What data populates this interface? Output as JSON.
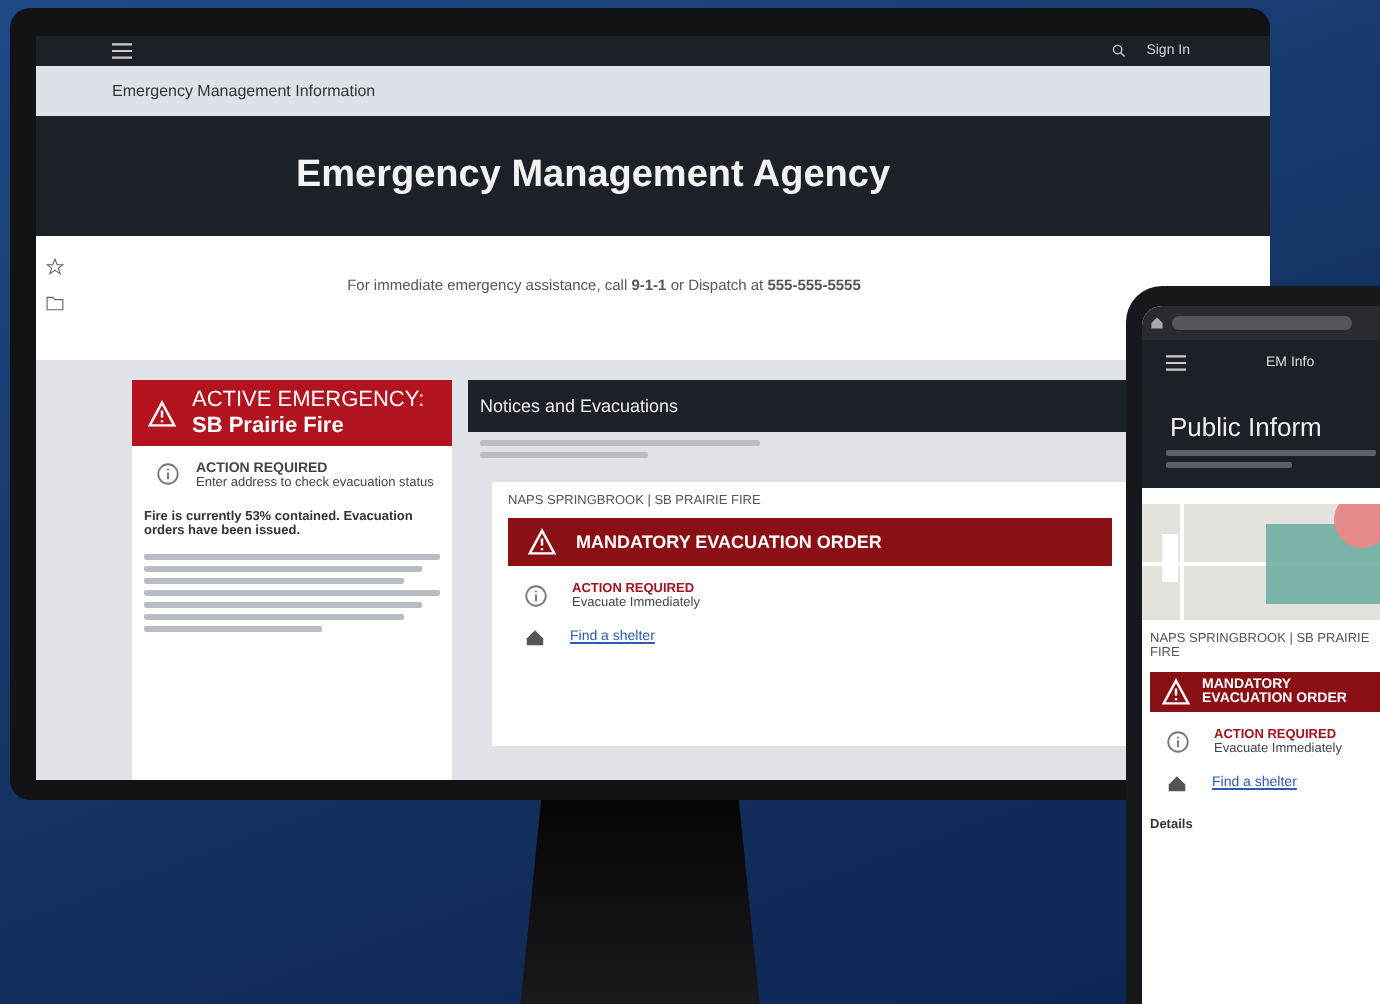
{
  "desktop": {
    "nav": {
      "sign_in": "Sign In"
    },
    "info_bar": {
      "title": "Emergency Management Information"
    },
    "hero": {
      "title": "Emergency Management Agency"
    },
    "notice": {
      "text": "For immediate emergency assistance, call **9-1-1** or Dispatch at **555-555-5555**"
    },
    "alert_card": {
      "title": "ACTIVE EMERGENCY: **SB Prairie Fire**",
      "action_title": "ACTION REQUIRED",
      "action_text": "Enter address to check evacuation status",
      "summary": "Fire is currently 53% contained. Evacuation orders have been issued."
    },
    "notices_panel": {
      "title": "Notices and Evacuations",
      "card": {
        "zone": "NAPS SPRINGBROOK | SB PRAIRIE FIRE",
        "order": "MANDATORY EVACUATION ORDER",
        "action_title": "ACTION REQUIRED",
        "action_text": "Evacuate Immediately",
        "link": "Find a shelter"
      }
    }
  },
  "phone": {
    "nav": {
      "title": "EM Info"
    },
    "hero": {
      "title": "Public Inform"
    },
    "card": {
      "zone": "NAPS SPRINGBROOK | SB PRAIRIE FIRE",
      "order": "MANDATORY EVACUATION ORDER",
      "action_title": "ACTION REQUIRED",
      "action_text": "Evacuate Immediately",
      "link": "Find a shelter",
      "details": "Details"
    }
  }
}
